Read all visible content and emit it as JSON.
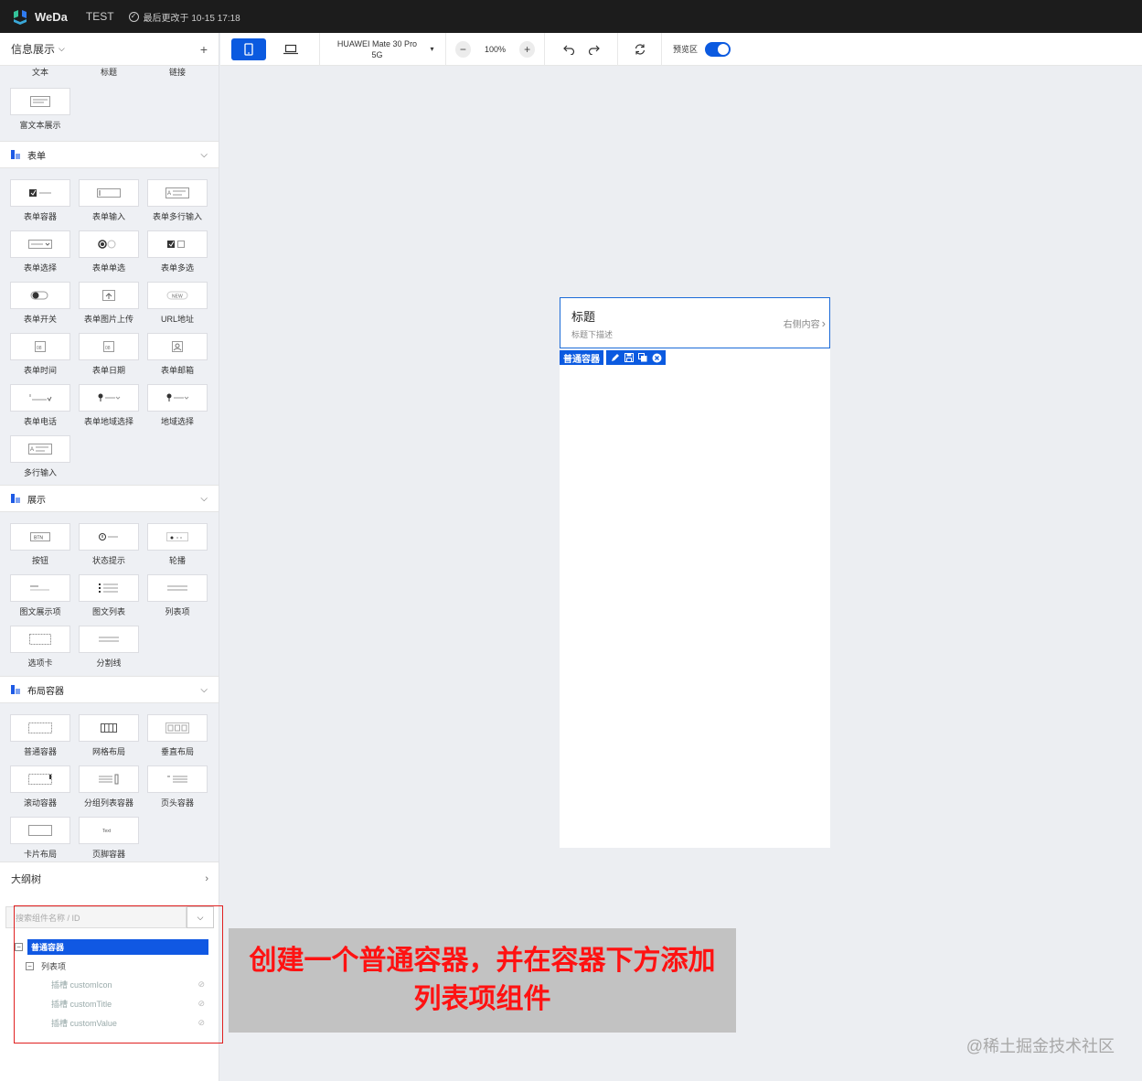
{
  "topbar": {
    "logo_text": "WeDa",
    "app_name": "TEST",
    "saved_status": "最后更改于 10-15 17:18"
  },
  "left_panel": {
    "header": {
      "title": "信息展示",
      "add": "+"
    },
    "partial_row": [
      "文本",
      "标题",
      "链接"
    ],
    "info_tiles": [
      {
        "label": "富文本展示",
        "icon": "richtext-icon"
      }
    ],
    "sections": [
      {
        "title": "表单",
        "tiles": [
          {
            "label": "表单容器",
            "icon": "form-container-icon"
          },
          {
            "label": "表单输入",
            "icon": "input-icon"
          },
          {
            "label": "表单多行输入",
            "icon": "textarea-icon"
          },
          {
            "label": "表单选择",
            "icon": "select-icon"
          },
          {
            "label": "表单单选",
            "icon": "radio-icon"
          },
          {
            "label": "表单多选",
            "icon": "checkbox-icon"
          },
          {
            "label": "表单开关",
            "icon": "switch-icon"
          },
          {
            "label": "表单图片上传",
            "icon": "upload-icon"
          },
          {
            "label": "URL地址",
            "icon": "url-icon"
          },
          {
            "label": "表单时间",
            "icon": "time-icon"
          },
          {
            "label": "表单日期",
            "icon": "date-icon"
          },
          {
            "label": "表单邮箱",
            "icon": "email-icon"
          },
          {
            "label": "表单电话",
            "icon": "phone-icon"
          },
          {
            "label": "表单地域选择",
            "icon": "region-icon"
          },
          {
            "label": "地域选择",
            "icon": "region-select-icon"
          },
          {
            "label": "多行输入",
            "icon": "multiline-icon"
          }
        ]
      },
      {
        "title": "展示",
        "tiles": [
          {
            "label": "按钮",
            "icon": "button-icon"
          },
          {
            "label": "状态提示",
            "icon": "status-icon"
          },
          {
            "label": "轮播",
            "icon": "carousel-icon"
          },
          {
            "label": "图文展示项",
            "icon": "media-item-icon"
          },
          {
            "label": "图文列表",
            "icon": "media-list-icon"
          },
          {
            "label": "列表项",
            "icon": "list-item-icon"
          },
          {
            "label": "选项卡",
            "icon": "tabs-icon"
          },
          {
            "label": "分割线",
            "icon": "divider-icon"
          }
        ]
      },
      {
        "title": "布局容器",
        "tiles": [
          {
            "label": "普通容器",
            "icon": "container-icon"
          },
          {
            "label": "网格布局",
            "icon": "grid-icon"
          },
          {
            "label": "垂直布局",
            "icon": "vertical-icon"
          },
          {
            "label": "滚动容器",
            "icon": "scroll-icon"
          },
          {
            "label": "分组列表容器",
            "icon": "group-list-icon"
          },
          {
            "label": "页头容器",
            "icon": "header-icon"
          },
          {
            "label": "卡片布局",
            "icon": "card-icon"
          },
          {
            "label": "页脚容器",
            "icon": "footer-icon"
          }
        ]
      }
    ],
    "outline": {
      "title": "大纲树",
      "search_placeholder": "搜索组件名称 / ID",
      "tree": {
        "root": "普通容器",
        "child": "列表项",
        "slots": [
          "插槽 customIcon",
          "插槽 customTitle",
          "插槽 customValue"
        ]
      }
    }
  },
  "toolbar": {
    "device_line1": "HUAWEI Mate 30 Pro",
    "device_line2": "5G",
    "zoom": "100%",
    "preview_label": "预览区"
  },
  "canvas": {
    "list_item": {
      "title": "标题",
      "description": "标题下描述",
      "right_content": "右侧内容"
    },
    "selection_label": "普通容器"
  },
  "annotation": "创建一个普通容器，并在容器下方添加列表项组件",
  "watermark": "@稀土掘金技术社区",
  "colors": {
    "accent": "#0b5ae0",
    "topbar": "#1c1c1c",
    "annotation_text": "#ff1212"
  }
}
